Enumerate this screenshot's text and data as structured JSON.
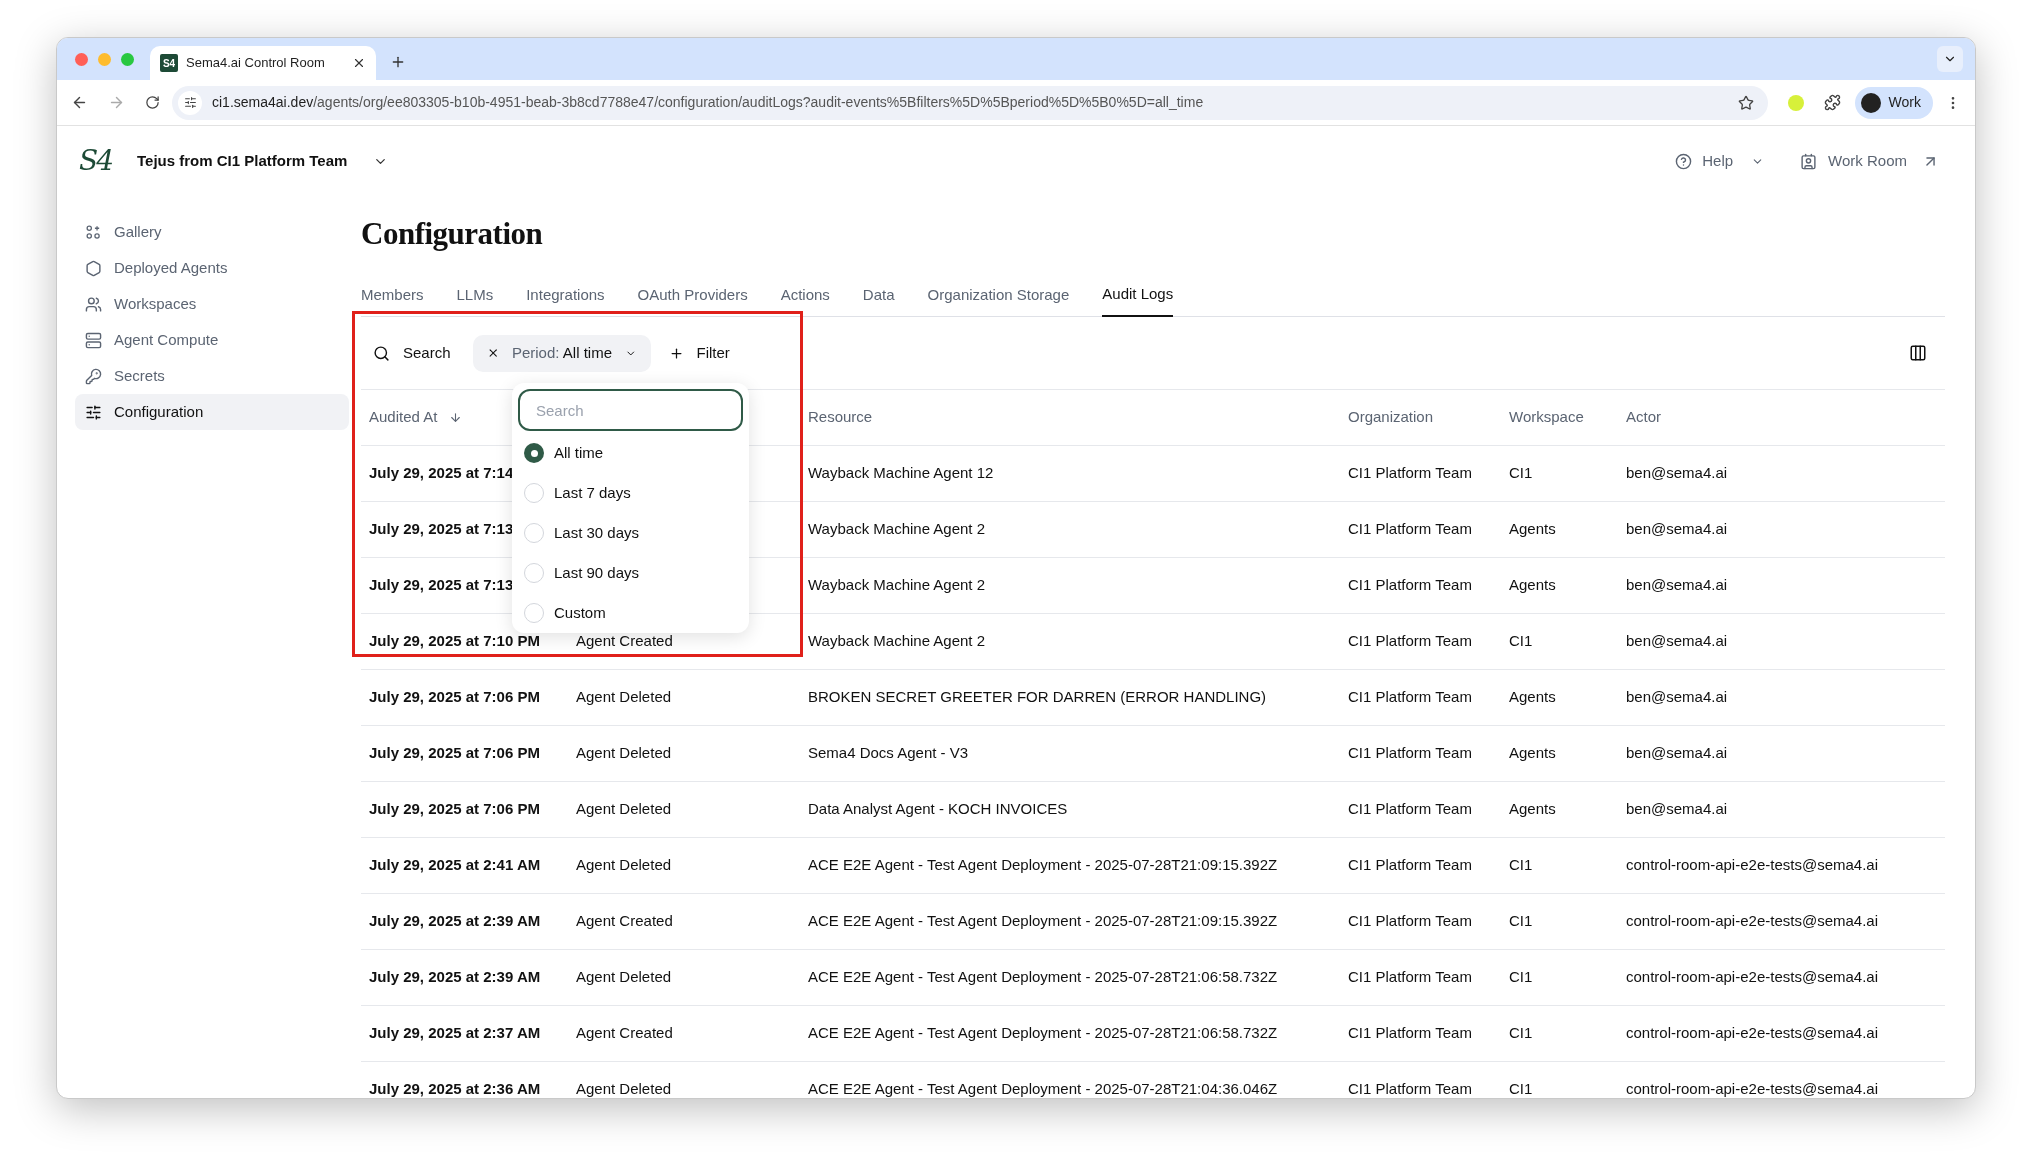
{
  "browser": {
    "favicon": "S4",
    "tab_title": "Sema4.ai Control Room",
    "url_host": "ci1.sema4ai.dev",
    "url_path": "/agents/org/ee803305-b10b-4951-beab-3b8cd7788e47/configuration/auditLogs?audit-events%5Bfilters%5D%5Bperiod%5D%5B0%5D=all_time",
    "profile": "Work"
  },
  "header": {
    "logo": "S4",
    "org": "Tejus from CI1 Platform Team",
    "help": "Help",
    "work_room": "Work Room"
  },
  "sidebar": {
    "items": [
      {
        "label": "Gallery",
        "kind": "gallery",
        "selected": false
      },
      {
        "label": "Deployed Agents",
        "kind": "agents",
        "selected": false
      },
      {
        "label": "Workspaces",
        "kind": "workspaces",
        "selected": false
      },
      {
        "label": "Agent Compute",
        "kind": "compute",
        "selected": false
      },
      {
        "label": "Secrets",
        "kind": "secrets",
        "selected": false
      },
      {
        "label": "Configuration",
        "kind": "configuration",
        "selected": true
      }
    ]
  },
  "title": "Configuration",
  "tabs": [
    {
      "label": "Members",
      "selected": false
    },
    {
      "label": "LLMs",
      "selected": false
    },
    {
      "label": "Integrations",
      "selected": false
    },
    {
      "label": "OAuth Providers",
      "selected": false
    },
    {
      "label": "Actions",
      "selected": false
    },
    {
      "label": "Data",
      "selected": false
    },
    {
      "label": "Organization Storage",
      "selected": false
    },
    {
      "label": "Audit Logs",
      "selected": true
    }
  ],
  "toolbar": {
    "search": "Search",
    "period_label": "Period:",
    "period_value": "All time",
    "filter": "Filter"
  },
  "period_menu": {
    "placeholder": "Search",
    "options": [
      {
        "label": "All time",
        "selected": true
      },
      {
        "label": "Last 7 days",
        "selected": false
      },
      {
        "label": "Last 30 days",
        "selected": false
      },
      {
        "label": "Last 90 days",
        "selected": false
      },
      {
        "label": "Custom",
        "selected": false
      }
    ]
  },
  "table": {
    "columns": [
      "Audited At",
      "Resource",
      "Organization",
      "Workspace",
      "Actor"
    ],
    "rows": [
      {
        "audited_at": "July 29, 2025 at 7:14",
        "resource": "Wayback Machine Agent 12",
        "organization": "CI1 Platform Team",
        "workspace": "CI1",
        "actor": "ben@sema4.ai"
      },
      {
        "audited_at": "July 29, 2025 at 7:13",
        "resource": "Wayback Machine Agent 2",
        "organization": "CI1 Platform Team",
        "workspace": "Agents",
        "actor": "ben@sema4.ai"
      },
      {
        "audited_at": "July 29, 2025 at 7:13",
        "resource": "Wayback Machine Agent 2",
        "organization": "CI1 Platform Team",
        "workspace": "Agents",
        "actor": "ben@sema4.ai"
      },
      {
        "audited_at": "July 29, 2025 at 7:10 PM",
        "action": "Agent Created",
        "resource": "Wayback Machine Agent 2",
        "organization": "CI1 Platform Team",
        "workspace": "CI1",
        "actor": "ben@sema4.ai"
      },
      {
        "audited_at": "July 29, 2025 at 7:06 PM",
        "action": "Agent Deleted",
        "resource": "BROKEN SECRET GREETER FOR DARREN (ERROR HANDLING)",
        "organization": "CI1 Platform Team",
        "workspace": "Agents",
        "actor": "ben@sema4.ai"
      },
      {
        "audited_at": "July 29, 2025 at 7:06 PM",
        "action": "Agent Deleted",
        "resource": "Sema4 Docs Agent - V3",
        "organization": "CI1 Platform Team",
        "workspace": "Agents",
        "actor": "ben@sema4.ai"
      },
      {
        "audited_at": "July 29, 2025 at 7:06 PM",
        "action": "Agent Deleted",
        "resource": "Data Analyst Agent - KOCH INVOICES",
        "organization": "CI1 Platform Team",
        "workspace": "Agents",
        "actor": "ben@sema4.ai"
      },
      {
        "audited_at": "July 29, 2025 at 2:41 AM",
        "action": "Agent Deleted",
        "resource": "ACE E2E Agent - Test Agent Deployment - 2025-07-28T21:09:15.392Z",
        "organization": "CI1 Platform Team",
        "workspace": "CI1",
        "actor": "control-room-api-e2e-tests@sema4.ai"
      },
      {
        "audited_at": "July 29, 2025 at 2:39 AM",
        "action": "Agent Created",
        "resource": "ACE E2E Agent - Test Agent Deployment - 2025-07-28T21:09:15.392Z",
        "organization": "CI1 Platform Team",
        "workspace": "CI1",
        "actor": "control-room-api-e2e-tests@sema4.ai"
      },
      {
        "audited_at": "July 29, 2025 at 2:39 AM",
        "action": "Agent Deleted",
        "resource": "ACE E2E Agent - Test Agent Deployment - 2025-07-28T21:06:58.732Z",
        "organization": "CI1 Platform Team",
        "workspace": "CI1",
        "actor": "control-room-api-e2e-tests@sema4.ai"
      },
      {
        "audited_at": "July 29, 2025 at 2:37 AM",
        "action": "Agent Created",
        "resource": "ACE E2E Agent - Test Agent Deployment - 2025-07-28T21:06:58.732Z",
        "organization": "CI1 Platform Team",
        "workspace": "CI1",
        "actor": "control-room-api-e2e-tests@sema4.ai"
      },
      {
        "audited_at": "July 29, 2025 at 2:36 AM",
        "action": "Agent Deleted",
        "resource": "ACE E2E Agent - Test Agent Deployment - 2025-07-28T21:04:36.046Z",
        "organization": "CI1 Platform Team",
        "workspace": "CI1",
        "actor": "control-room-api-e2e-tests@sema4.ai"
      }
    ]
  }
}
